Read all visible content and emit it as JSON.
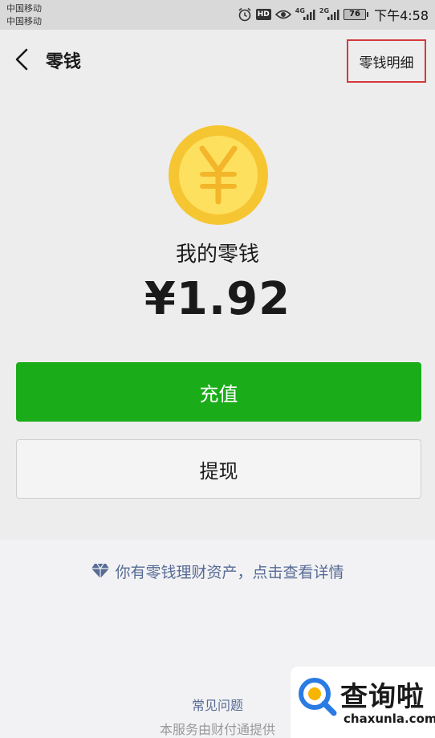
{
  "status_bar": {
    "carrier_1": "中国移动",
    "carrier_2": "中国移动",
    "hd_label": "HD",
    "network_1": "4G",
    "network_2": "2G",
    "battery": "76",
    "time": "下午4:58",
    "icons": [
      "alarm-icon",
      "eye-icon",
      "signal-icon",
      "signal-icon"
    ]
  },
  "nav": {
    "title": "零钱",
    "detail_link": "零钱明细",
    "back_icon": "chevron-left-icon",
    "highlight_color": "#d6383a"
  },
  "balance": {
    "coin_icon": "yen-coin-icon",
    "label": "我的零钱",
    "amount": "¥1.92"
  },
  "actions": {
    "recharge": "充值",
    "withdraw": "提现",
    "primary_color": "#1aad19"
  },
  "wealth": {
    "icon": "diamond-icon",
    "text": "你有零钱理财资产，点击查看详情",
    "link_color": "#576b95"
  },
  "footer": {
    "faq": "常见问题",
    "provider": "本服务由财付通提供"
  },
  "watermark": {
    "title": "查询啦",
    "url": "chaxunla.com"
  }
}
